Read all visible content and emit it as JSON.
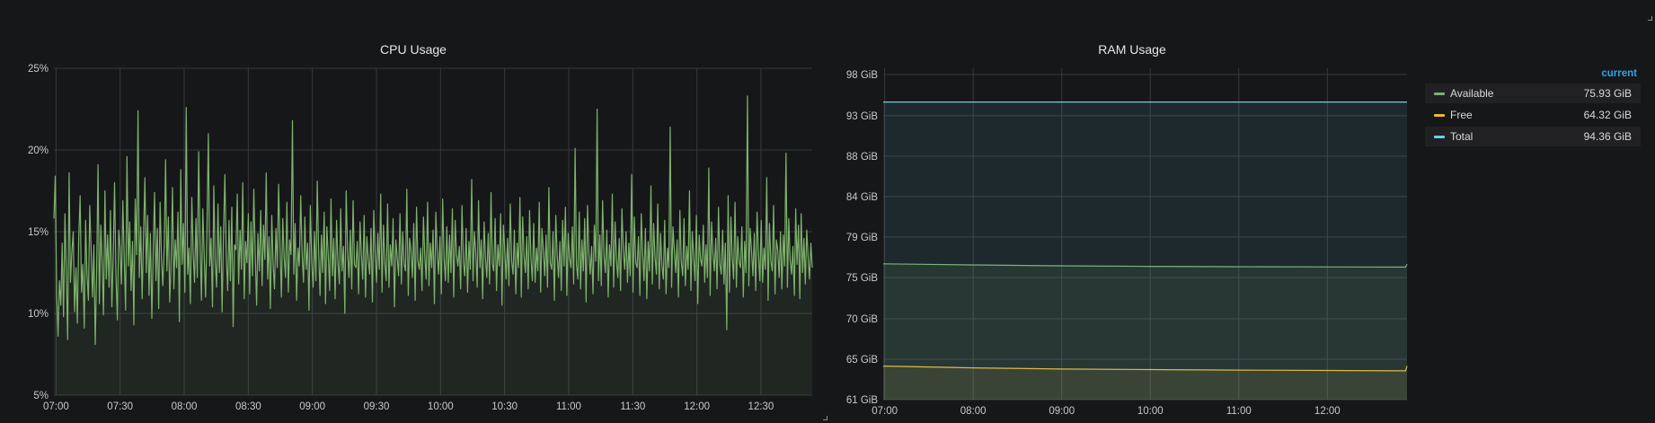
{
  "cpu_panel": {
    "title": "CPU Usage"
  },
  "ram_panel": {
    "title": "RAM Usage"
  },
  "legend": {
    "header": "current",
    "items": [
      {
        "name": "Available",
        "value": "75.93 GiB",
        "color": "#7eb26d"
      },
      {
        "name": "Free",
        "value": "64.32 GiB",
        "color": "#eab839"
      },
      {
        "name": "Total",
        "value": "94.36 GiB",
        "color": "#6ed0e0"
      }
    ]
  },
  "chart_data": [
    {
      "type": "area",
      "title": "CPU Usage",
      "x_ticks": [
        "07:00",
        "07:30",
        "08:00",
        "08:30",
        "09:00",
        "09:30",
        "10:00",
        "10:30",
        "11:00",
        "11:30",
        "12:00",
        "12:30"
      ],
      "x_range": [
        "06:59",
        "12:54"
      ],
      "y_ticks": [
        "5%",
        "10%",
        "15%",
        "20%",
        "25%"
      ],
      "ylim": [
        5,
        25
      ],
      "grid": true,
      "series": [
        {
          "color": "#7eb26d",
          "values": [
            15.8,
            18.4,
            11.2,
            8.6,
            12.0,
            10.5,
            14.3,
            9.8,
            16.1,
            12.6,
            8.4,
            18.6,
            11.9,
            13.7,
            15.0,
            10.1,
            12.8,
            9.4,
            14.6,
            17.2,
            11.3,
            13.0,
            9.1,
            15.7,
            12.4,
            10.8,
            16.6,
            13.9,
            11.0,
            14.2,
            8.1,
            12.7,
            19.1,
            10.6,
            15.4,
            13.2,
            9.9,
            17.5,
            12.1,
            14.8,
            11.6,
            16.3,
            10.4,
            13.5,
            18.0,
            12.3,
            9.6,
            15.1,
            14.0,
            11.8,
            16.9,
            13.3,
            10.2,
            19.6,
            12.9,
            15.6,
            11.4,
            14.4,
            9.3,
            17.0,
            13.6,
            22.4,
            12.2,
            15.3,
            10.9,
            14.7,
            18.3,
            12.5,
            16.0,
            11.1,
            14.9,
            9.7,
            13.8,
            17.4,
            12.0,
            15.2,
            10.3,
            16.8,
            13.4,
            11.7,
            14.1,
            19.4,
            12.6,
            15.9,
            10.7,
            13.1,
            17.7,
            11.5,
            14.5,
            12.8,
            16.2,
            9.5,
            18.8,
            13.0,
            15.5,
            11.3,
            22.6,
            12.4,
            14.0,
            10.6,
            17.1,
            13.7,
            11.9,
            15.8,
            12.2,
            19.9,
            14.3,
            10.8,
            16.4,
            13.5,
            11.0,
            15.0,
            21.0,
            12.9,
            14.6,
            10.4,
            17.8,
            13.2,
            11.6,
            16.7,
            12.5,
            15.3,
            10.1,
            14.8,
            18.5,
            13.6,
            11.4,
            15.7,
            12.0,
            16.5,
            9.2,
            14.2,
            13.9,
            17.3,
            11.8,
            15.1,
            12.7,
            18.0,
            10.9,
            14.4,
            13.1,
            16.1,
            11.2,
            15.6,
            12.3,
            17.6,
            13.8,
            10.5,
            14.9,
            12.6,
            16.3,
            11.7,
            15.4,
            13.3,
            18.6,
            12.1,
            14.7,
            10.3,
            16.0,
            13.0,
            11.5,
            15.2,
            12.8,
            17.9,
            14.1,
            11.0,
            15.8,
            13.4,
            12.2,
            16.8,
            11.3,
            14.5,
            13.6,
            21.8,
            12.4,
            15.5,
            10.8,
            14.0,
            12.9,
            17.2,
            13.7,
            11.9,
            15.9,
            12.7,
            14.3,
            10.2,
            16.6,
            13.1,
            11.6,
            15.0,
            12.0,
            18.1,
            13.9,
            11.1,
            14.8,
            12.5,
            16.2,
            10.6,
            15.3,
            13.5,
            11.4,
            17.0,
            12.3,
            14.6,
            10.9,
            15.7,
            13.2,
            11.8,
            16.4,
            12.6,
            14.1,
            10.0,
            17.5,
            13.8,
            12.2,
            15.1,
            11.5,
            16.9,
            13.0,
            12.8,
            14.4,
            11.2,
            15.6,
            13.6,
            12.1,
            16.0,
            11.0,
            14.7,
            13.3,
            12.4,
            15.2,
            10.7,
            16.3,
            13.7,
            11.9,
            14.9,
            12.7,
            17.3,
            11.3,
            15.4,
            13.1,
            12.0,
            16.7,
            11.6,
            14.2,
            12.9,
            15.8,
            10.4,
            14.5,
            13.4,
            12.3,
            16.1,
            11.8,
            15.0,
            13.0,
            12.6,
            17.6,
            11.1,
            14.6,
            13.9,
            12.2,
            15.5,
            10.8,
            16.5,
            13.2,
            12.7,
            14.0,
            11.4,
            15.9,
            13.5,
            12.1,
            16.8,
            11.7,
            14.3,
            12.8,
            15.1,
            10.6,
            16.2,
            13.8,
            12.4,
            14.7,
            11.2,
            17.0,
            13.3,
            12.0,
            15.3,
            11.9,
            14.8,
            12.5,
            16.4,
            11.0,
            15.7,
            13.6,
            12.9,
            14.1,
            11.5,
            16.6,
            13.1,
            12.3,
            15.2,
            11.3,
            14.4,
            12.7,
            18.2,
            12.0,
            15.0,
            13.7,
            11.6,
            16.9,
            12.8,
            14.5,
            10.9,
            15.6,
            13.4,
            12.2,
            14.9,
            11.8,
            17.4,
            13.0,
            12.6,
            15.8,
            11.4,
            14.2,
            12.9,
            16.1,
            10.5,
            15.4,
            13.9,
            12.1,
            14.6,
            11.7,
            16.7,
            13.2,
            12.4,
            15.1,
            11.2,
            14.3,
            12.8,
            17.1,
            11.0,
            15.9,
            13.5,
            12.5,
            14.7,
            11.5,
            16.3,
            13.3,
            12.0,
            15.5,
            11.9,
            14.0,
            12.6,
            16.8,
            11.3,
            15.2,
            13.8,
            12.3,
            14.8,
            11.6,
            17.7,
            13.1,
            12.7,
            15.0,
            10.8,
            16.0,
            13.6,
            12.2,
            14.4,
            11.4,
            15.7,
            12.9,
            16.5,
            11.1,
            14.9,
            13.4,
            12.8,
            15.3,
            11.8,
            20.1,
            13.0,
            12.1,
            16.2,
            11.5,
            14.5,
            12.6,
            15.8,
            10.7,
            16.6,
            13.7,
            12.4,
            14.1,
            11.2,
            15.4,
            13.2,
            22.5,
            12.0,
            14.8,
            11.7,
            16.9,
            13.5,
            12.5,
            15.1,
            11.0,
            14.2,
            12.9,
            17.3,
            11.6,
            15.6,
            13.3,
            12.2,
            14.6,
            11.4,
            16.4,
            13.8,
            12.7,
            15.0,
            11.9,
            14.3,
            12.3,
            18.5,
            11.3,
            15.9,
            13.1,
            12.8,
            14.7,
            11.1,
            16.1,
            13.6,
            12.0,
            15.2,
            10.9,
            14.4,
            12.6,
            17.8,
            11.8,
            15.5,
            13.4,
            12.4,
            16.7,
            11.5,
            14.9,
            13.0,
            12.1,
            15.7,
            11.2,
            14.0,
            12.8,
            21.4,
            11.6,
            15.3,
            13.9,
            12.5,
            14.5,
            11.0,
            16.3,
            13.2,
            12.3,
            15.8,
            11.7,
            14.1,
            12.7,
            17.5,
            11.4,
            15.0,
            13.5,
            12.0,
            16.0,
            10.6,
            14.8,
            13.3,
            12.9,
            15.4,
            11.9,
            14.2,
            12.2,
            18.9,
            11.1,
            15.6,
            13.7,
            12.6,
            14.6,
            11.5,
            16.5,
            13.0,
            12.4,
            15.1,
            11.8,
            14.3,
            9.0,
            17.2,
            11.3,
            15.9,
            13.4,
            12.1,
            16.8,
            11.6,
            14.7,
            13.1,
            12.8,
            15.3,
            11.0,
            14.4,
            12.5,
            23.3,
            11.7,
            15.2,
            13.8,
            12.3,
            14.9,
            11.4,
            16.2,
            13.6,
            12.0,
            15.7,
            11.9,
            14.0,
            12.7,
            18.3,
            10.8,
            15.5,
            13.2,
            12.6,
            16.6,
            11.2,
            14.5,
            13.9,
            12.2,
            15.0,
            11.5,
            14.8,
            12.9,
            19.8,
            11.6,
            15.8,
            13.3,
            12.4,
            14.1,
            11.1,
            16.4,
            13.0,
            15.4,
            10.9,
            16.1,
            12.5,
            14.6,
            11.8,
            15.1,
            13.5,
            12.1,
            14.3,
            12.8
          ]
        }
      ]
    },
    {
      "type": "area",
      "title": "RAM Usage",
      "x_ticks": [
        "07:00",
        "08:00",
        "09:00",
        "10:00",
        "11:00",
        "12:00"
      ],
      "x_range": [
        "06:59",
        "12:54"
      ],
      "y_ticks": [
        "61 GiB",
        "65 GiB",
        "70 GiB",
        "75 GiB",
        "79 GiB",
        "84 GiB",
        "88 GiB",
        "93 GiB",
        "98 GiB"
      ],
      "ylim": [
        60.5,
        98.2
      ],
      "grid": true,
      "series": [
        {
          "name": "Available",
          "color": "#7eb26d",
          "x": [
            "06:59",
            "08:00",
            "09:00",
            "10:00",
            "11:00",
            "12:00",
            "12:53",
            "12:54"
          ],
          "values": [
            75.95,
            75.83,
            75.72,
            75.66,
            75.62,
            75.6,
            75.58,
            75.93
          ]
        },
        {
          "name": "Free",
          "color": "#eab839",
          "x": [
            "06:59",
            "08:00",
            "09:00",
            "10:00",
            "11:00",
            "12:00",
            "12:53",
            "12:54"
          ],
          "values": [
            64.32,
            64.12,
            63.98,
            63.92,
            63.86,
            63.82,
            63.78,
            64.32
          ]
        },
        {
          "name": "Total",
          "color": "#6ed0e0",
          "x": [
            "06:59",
            "12:54"
          ],
          "values": [
            94.36,
            94.36
          ]
        }
      ]
    }
  ]
}
